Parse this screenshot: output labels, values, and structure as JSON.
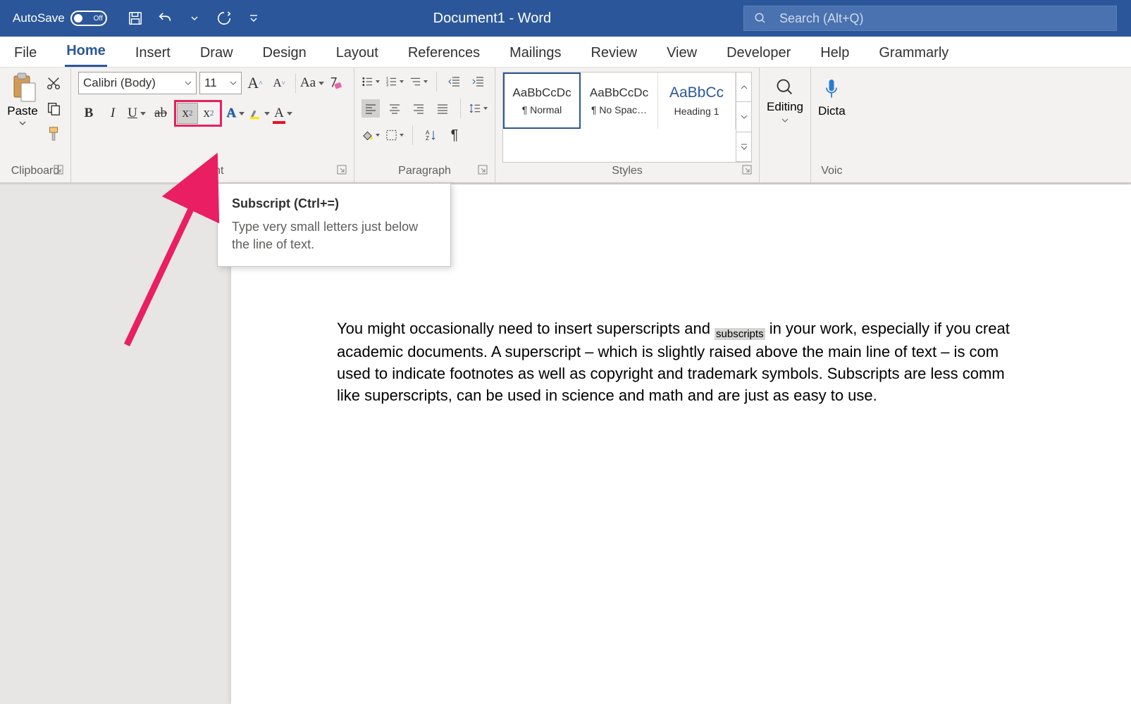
{
  "titleBar": {
    "autoSave": "AutoSave",
    "autoSaveState": "Off",
    "docTitle": "Document1  -  Word",
    "searchPlaceholder": "Search (Alt+Q)"
  },
  "tabs": [
    "File",
    "Home",
    "Insert",
    "Draw",
    "Design",
    "Layout",
    "References",
    "Mailings",
    "Review",
    "View",
    "Developer",
    "Help",
    "Grammarly"
  ],
  "activeTab": "Home",
  "groups": {
    "clipboard": {
      "label": "Clipboard",
      "paste": "Paste"
    },
    "font": {
      "label": "Font",
      "fontName": "Calibri (Body)",
      "fontSize": "11",
      "caseLabel": "Aa"
    },
    "paragraph": {
      "label": "Paragraph"
    },
    "styles": {
      "label": "Styles",
      "items": [
        {
          "preview": "AaBbCcDc",
          "name": "¶ Normal",
          "heading": false
        },
        {
          "preview": "AaBbCcDc",
          "name": "¶ No Spac…",
          "heading": false
        },
        {
          "preview": "AaBbCc",
          "name": "Heading 1",
          "heading": true
        }
      ]
    },
    "editing": {
      "label": "Editing"
    },
    "voice": {
      "label": "Voic",
      "dictate": "Dicta"
    }
  },
  "tooltip": {
    "title": "Subscript (Ctrl+=)",
    "body": "Type very small letters just below the line of text."
  },
  "document": {
    "t1": "You might occasionally need to insert superscripts and ",
    "sel": "subscripts",
    "t2": " in your work, especially if you creat",
    "t3": "academic documents. A superscript – which is slightly raised above the main line of text – is com",
    "t4": "used to indicate footnotes as well as copyright and trademark symbols. Subscripts are less comm",
    "t5": "like superscripts, can be used in science and math and are just as easy to use."
  }
}
